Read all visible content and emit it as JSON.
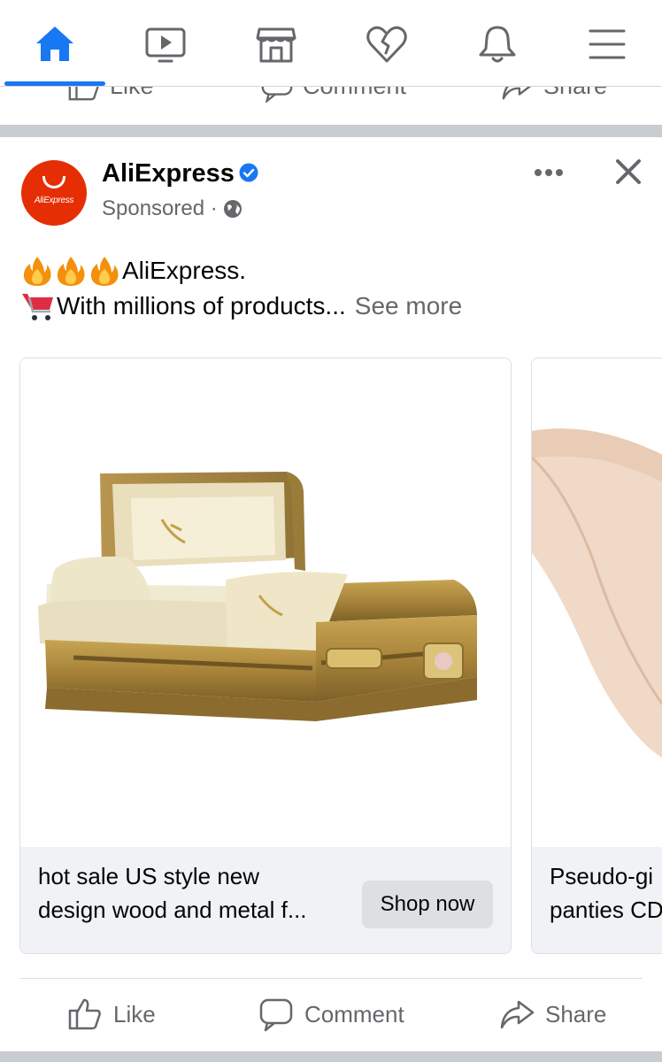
{
  "nav": {
    "items": [
      {
        "name": "home",
        "icon": "home-icon",
        "active": true
      },
      {
        "name": "watch",
        "icon": "video-icon",
        "active": false
      },
      {
        "name": "marketplace",
        "icon": "shop-icon",
        "active": false
      },
      {
        "name": "dating",
        "icon": "heart-icon",
        "active": false
      },
      {
        "name": "notifications",
        "icon": "bell-icon",
        "active": false
      },
      {
        "name": "menu",
        "icon": "menu-icon",
        "active": false
      }
    ],
    "accent_color": "#1877f2"
  },
  "prev_post": {
    "like_label": "Like",
    "comment_label": "Comment",
    "share_label": "Share"
  },
  "post": {
    "page_name": "AliExpress",
    "avatar_text": "AliExpress",
    "sponsored": "Sponsored ·",
    "text_line1": "AliExpress.",
    "text_line2": "With millions of products...",
    "see_more": "See more",
    "cards": [
      {
        "title_line1": "hot sale US style new",
        "title_line2": "design wood and metal f...",
        "cta": "Shop now",
        "image": "casket"
      },
      {
        "title_line1": "Pseudo-gi",
        "title_line2": "panties CD",
        "image": "panties"
      }
    ],
    "actions": {
      "like_label": "Like",
      "comment_label": "Comment",
      "share_label": "Share"
    }
  }
}
